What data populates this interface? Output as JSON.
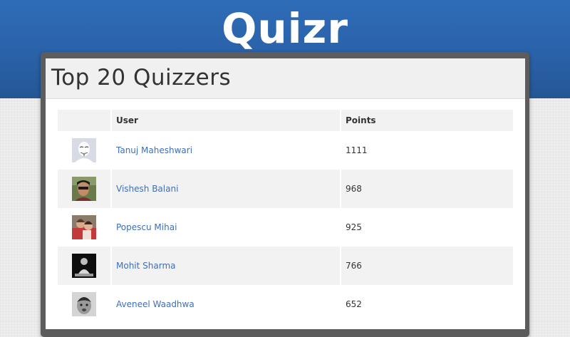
{
  "header": {
    "logo_text": "Quizr",
    "band_color": "#2a62a8"
  },
  "page": {
    "title": "Top 20 Quizzers"
  },
  "table": {
    "columns": [
      "",
      "User",
      "Points"
    ],
    "rows": [
      {
        "avatar": "anonymous-mask-avatar-icon",
        "user": "Tanuj Maheshwari",
        "points": "1111"
      },
      {
        "avatar": "user-photo-avatar",
        "user": "Vishesh Balani",
        "points": "968"
      },
      {
        "avatar": "user-photo-avatar",
        "user": "Popescu Mihai",
        "points": "925"
      },
      {
        "avatar": "user-photo-avatar",
        "user": "Mohit Sharma",
        "points": "766"
      },
      {
        "avatar": "user-photo-avatar",
        "user": "Aveneel Waadhwa",
        "points": "652"
      }
    ]
  },
  "colors": {
    "link": "#3f6fb6",
    "row_alt": "#f2f2f2",
    "frame": "#5c5c5c"
  }
}
